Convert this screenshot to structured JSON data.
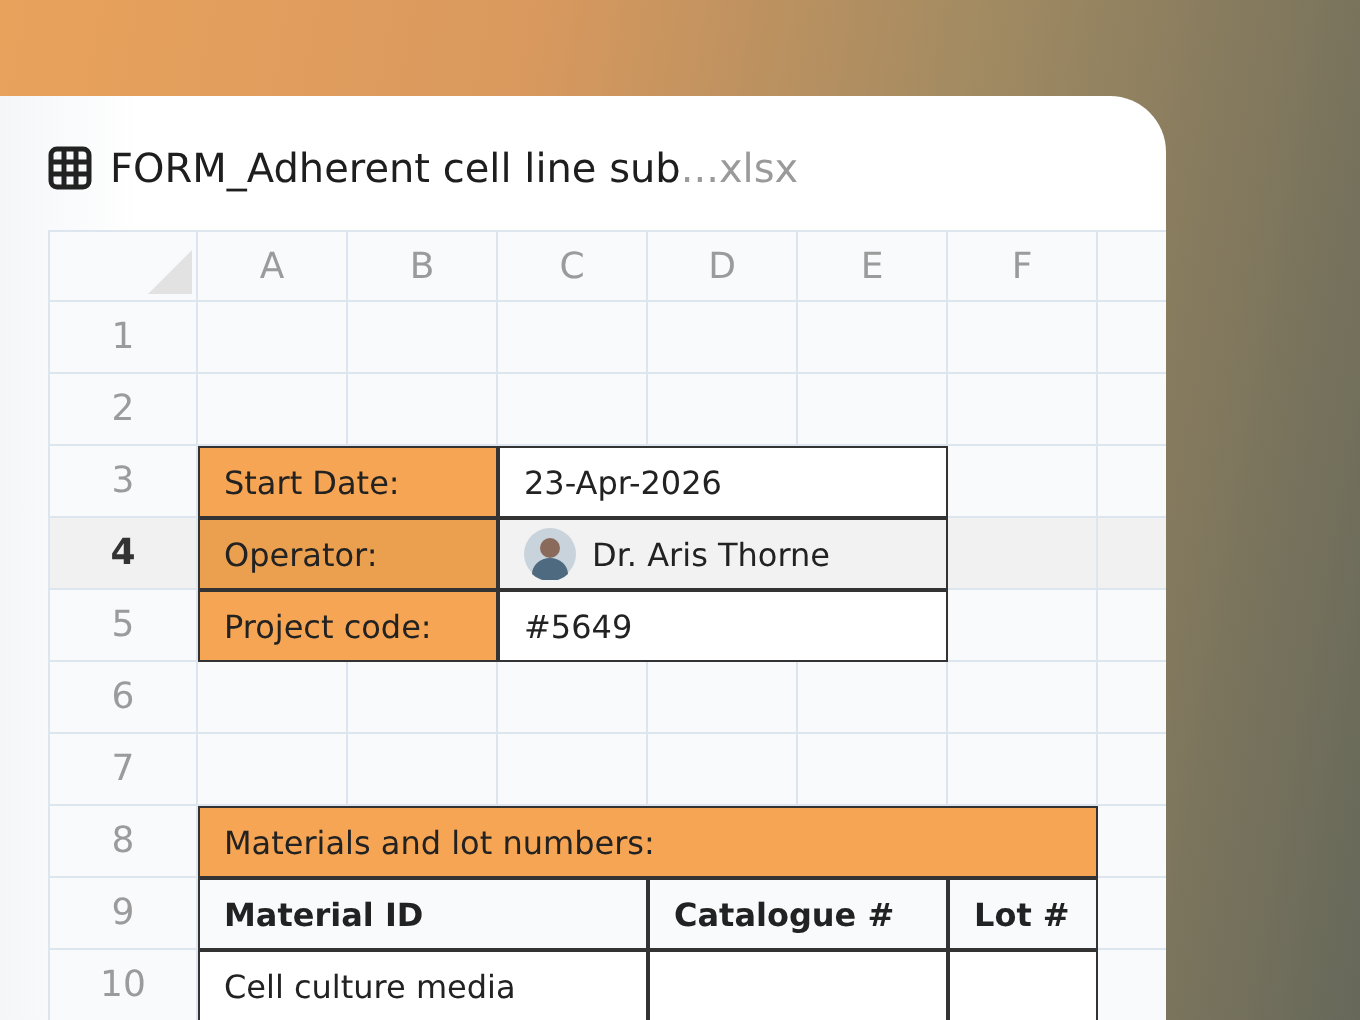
{
  "file": {
    "name": "FORM_Adherent cell line sub",
    "extension": "...xlsx"
  },
  "columns": [
    "A",
    "B",
    "C",
    "D",
    "E",
    "F"
  ],
  "rows": [
    {
      "label": "1",
      "selected": false
    },
    {
      "label": "2",
      "selected": false
    },
    {
      "label": "3",
      "selected": false
    },
    {
      "label": "4",
      "selected": true
    },
    {
      "label": "5",
      "selected": false
    },
    {
      "label": "6",
      "selected": false
    },
    {
      "label": "7",
      "selected": false
    },
    {
      "label": "8",
      "selected": false
    },
    {
      "label": "9",
      "selected": false
    },
    {
      "label": "10",
      "selected": false
    }
  ],
  "details": [
    {
      "kind": "text",
      "label": "Start Date:",
      "value": "23-Apr-2026"
    },
    {
      "kind": "person",
      "label": "Operator:",
      "value": "Dr. Aris Thorne"
    },
    {
      "kind": "text",
      "label": "Project code:",
      "value": "#5649"
    }
  ],
  "materials": {
    "title": "Materials and lot numbers:",
    "columns": [
      "Material ID",
      "Catalogue #",
      "Lot #"
    ],
    "rows": [
      {
        "material_id": "Cell culture media"
      }
    ]
  }
}
